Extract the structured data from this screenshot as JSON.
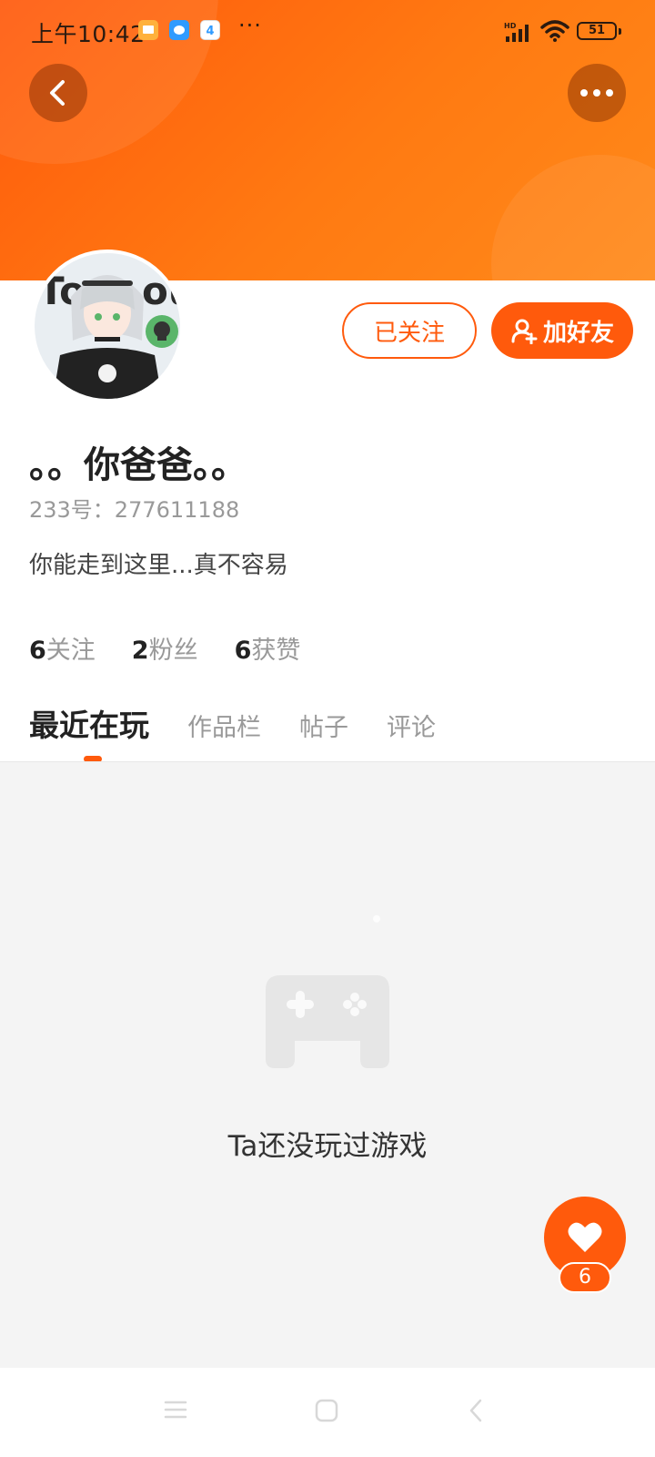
{
  "status_bar": {
    "time": "上午10:42",
    "notification_icons": [
      "gallery-icon",
      "messages-icon",
      "calendar-icon"
    ],
    "calendar_day": "4",
    "overflow": "···",
    "battery": "51"
  },
  "header": {
    "back_icon": "chevron-left-icon",
    "more_icon": "more-dots-icon"
  },
  "profile": {
    "username": "。。你爸爸。。",
    "uid": "233号：277611188",
    "bio": "你能走到这里...真不容易",
    "follow_button": "已关注",
    "add_friend_button": "加好友",
    "stats": [
      {
        "num": "6",
        "label": "关注"
      },
      {
        "num": "2",
        "label": "粉丝"
      },
      {
        "num": "6",
        "label": "获赞"
      }
    ]
  },
  "tabs": [
    {
      "label": "最近在玩",
      "active": true
    },
    {
      "label": "作品栏",
      "active": false
    },
    {
      "label": "帖子",
      "active": false
    },
    {
      "label": "评论",
      "active": false
    }
  ],
  "empty_state": {
    "icon": "gamepad-icon",
    "text": "Ta还没玩过游戏"
  },
  "like": {
    "icon": "heart-icon",
    "count": "6"
  },
  "colors": {
    "accent": "#ff5a0c",
    "banner_start": "#ff5a0c",
    "banner_end": "#ff8a1a",
    "content_bg": "#f4f4f4"
  }
}
